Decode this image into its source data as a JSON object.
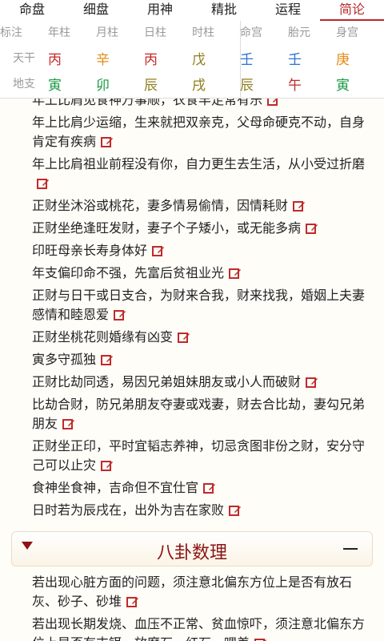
{
  "tabs": [
    "命盘",
    "细盘",
    "用神",
    "精批",
    "运程",
    "简论"
  ],
  "pillars": {
    "header_left": [
      "标注",
      "年柱",
      "月柱",
      "日柱",
      "时柱"
    ],
    "header_right": [
      "命宫",
      "胎元",
      "身宫"
    ],
    "row_labels": [
      "天干",
      "地支"
    ],
    "tiangan": [
      "丙",
      "辛",
      "丙",
      "戊",
      "壬",
      "壬",
      "庚"
    ],
    "dizhi": [
      "寅",
      "卯",
      "辰",
      "戌",
      "辰",
      "午",
      "寅"
    ],
    "colors": {
      "red": "#c62828",
      "orange": "#e48b18",
      "blue": "#2f73d6",
      "olive": "#8f7d1c",
      "green": "#1a9a42"
    }
  },
  "items": [
    "年上比肩见食神万事顺，衣食丰足常有乐",
    "年上比肩少运缩，生来就把双亲克，父母命硬克不动，自身肯定有疾病",
    "年上比肩祖业前程没有你，自力更生去生活，从小受过折磨",
    "正财坐沐浴或桃花，妻多情易偷情，因情耗财",
    "正财坐绝逢旺发财，妻子个子矮小，或无能多病",
    "印旺母亲长寿身体好",
    "年支偏印命不强，先富后贫祖业光",
    "正财与日干或日支合，为财来合我，财来找我，婚姻上夫妻感情和睦恩爱",
    "正财坐桃花则婚缘有凶变",
    "寅多守孤独",
    "正财比劫同透，易因兄弟姐妹朋友或小人而破财",
    "比劫合财，防兄弟朋友夺妻或戏妻，财去合比劫，妻勾兄弟朋友",
    "正财坐正印，平时宜韬志养神，切忌贪图非份之财，安分守己可以止灾",
    "食神坐食神，吉命但不宜仕官",
    "日时若为辰戌在，出外为吉在家败"
  ],
  "section_title": "八卦数理",
  "section_items": [
    "若出现心脏方面的问题，须注意北偏东方位上是否有放石灰、砂子、砂堆",
    "若出现长期发烧、血压不正常、贫血惊吓，须注意北偏东方位上是否有支铒、放磨石、红石、嘿差"
  ]
}
